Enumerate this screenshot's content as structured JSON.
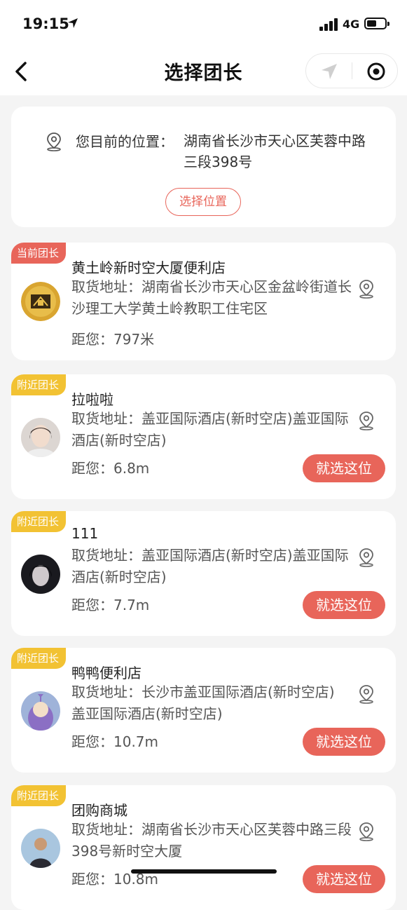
{
  "status_bar": {
    "time": "19:15",
    "network": "4G"
  },
  "nav": {
    "title": "选择团长"
  },
  "location": {
    "label": "您目前的位置：",
    "value": "湖南省长沙市天心区芙蓉中路三段398号",
    "choose_button": "选择位置"
  },
  "leaders": [
    {
      "tag": "当前团长",
      "name": "黄土岭新时空大厦便利店",
      "address": "取货地址：湖南省长沙市天心区金盆岭街道长沙理工大学黄土岭教职工住宅区",
      "distance": "距您：797米"
    },
    {
      "tag": "附近团长",
      "name": "拉啦啦",
      "address": "取货地址：盖亚国际酒店(新时空店)盖亚国际酒店(新时空店)",
      "distance": "距您：6.8m",
      "button": "就选这位"
    },
    {
      "tag": "附近团长",
      "name": "111",
      "address": "取货地址：盖亚国际酒店(新时空店)盖亚国际酒店(新时空店)",
      "distance": "距您：7.7m",
      "button": "就选这位"
    },
    {
      "tag": "附近团长",
      "name": "鸭鸭便利店",
      "address": "取货地址：长沙市盖亚国际酒店(新时空店)盖亚国际酒店(新时空店)",
      "distance": "距您：10.7m",
      "button": "就选这位"
    },
    {
      "tag": "附近团长",
      "name": "团购商城",
      "address": "取货地址：湖南省长沙市天心区芙蓉中路三段398号新时空大厦",
      "distance": "距您：10.8m",
      "button": "就选这位"
    }
  ],
  "colors": {
    "accent": "#e8655a",
    "tag_nearby": "#f2c233",
    "background": "#f4f4f4"
  }
}
